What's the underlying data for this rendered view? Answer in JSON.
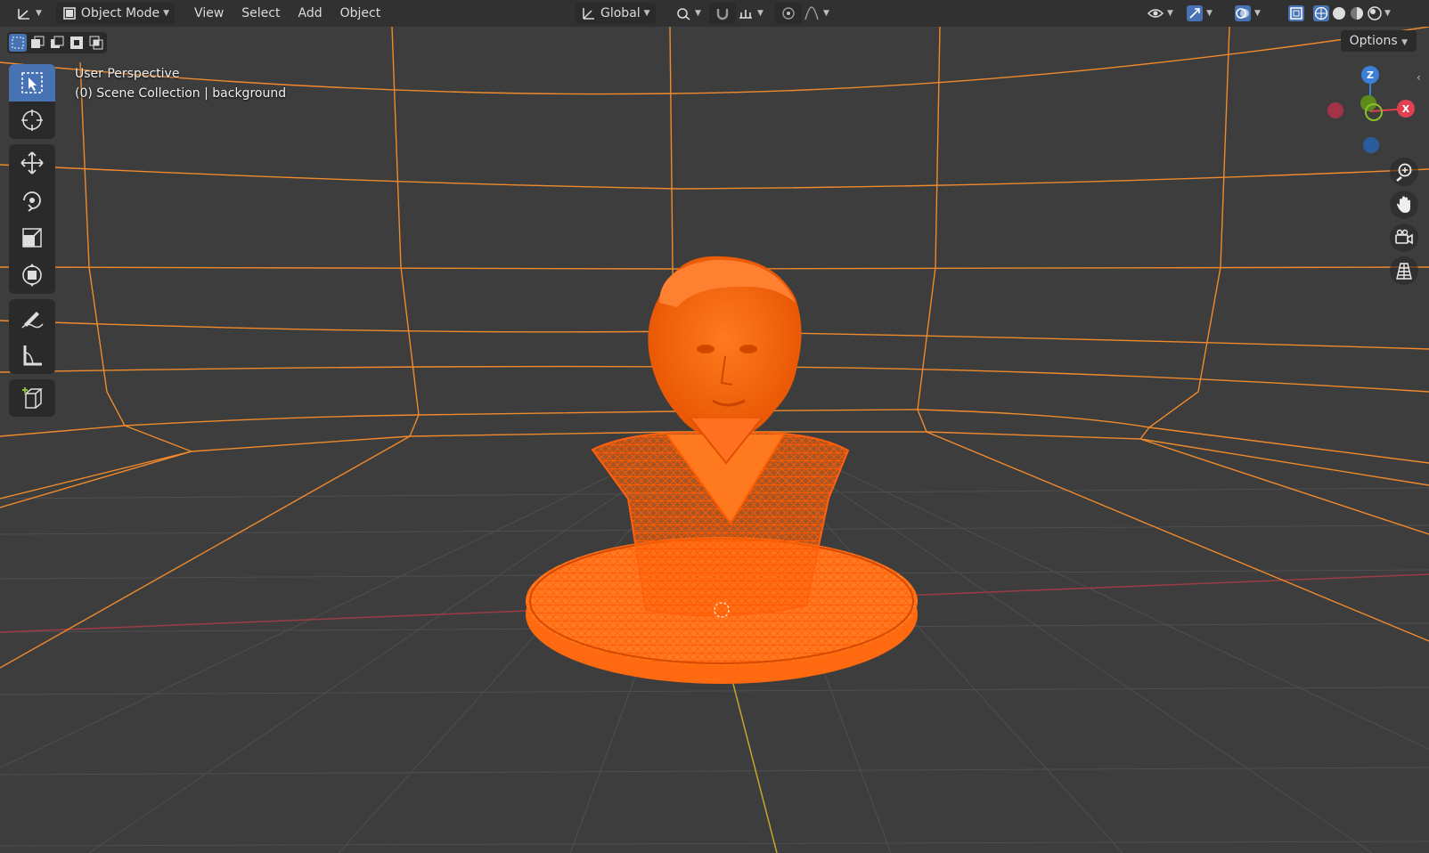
{
  "header": {
    "editor_type_icon": "axes-editor-icon",
    "mode": "Object Mode",
    "menus": [
      "View",
      "Select",
      "Add",
      "Object"
    ],
    "orientation": "Global",
    "options_label": "Options"
  },
  "viewport": {
    "perspective_label": "User Perspective",
    "collection_label": "(0) Scene Collection | background"
  },
  "toolbar": {
    "tools": [
      "select-box-tool",
      "cursor-tool",
      "move-tool",
      "rotate-tool",
      "scale-tool",
      "transform-tool",
      "annotate-tool",
      "measure-tool",
      "add-cube-tool"
    ],
    "active_tool": "select-box-tool"
  },
  "gizmo": {
    "z_label": "Z",
    "x_label": "X",
    "colors": {
      "x": "#e0404f",
      "y": "#8bbf2a",
      "z": "#3b7fd6"
    }
  },
  "colors": {
    "accent": "#4772b3",
    "selection": "#ff6a10",
    "background": "#3d3d3d",
    "grid_line": "#555555",
    "outline": "#f08a2c"
  }
}
